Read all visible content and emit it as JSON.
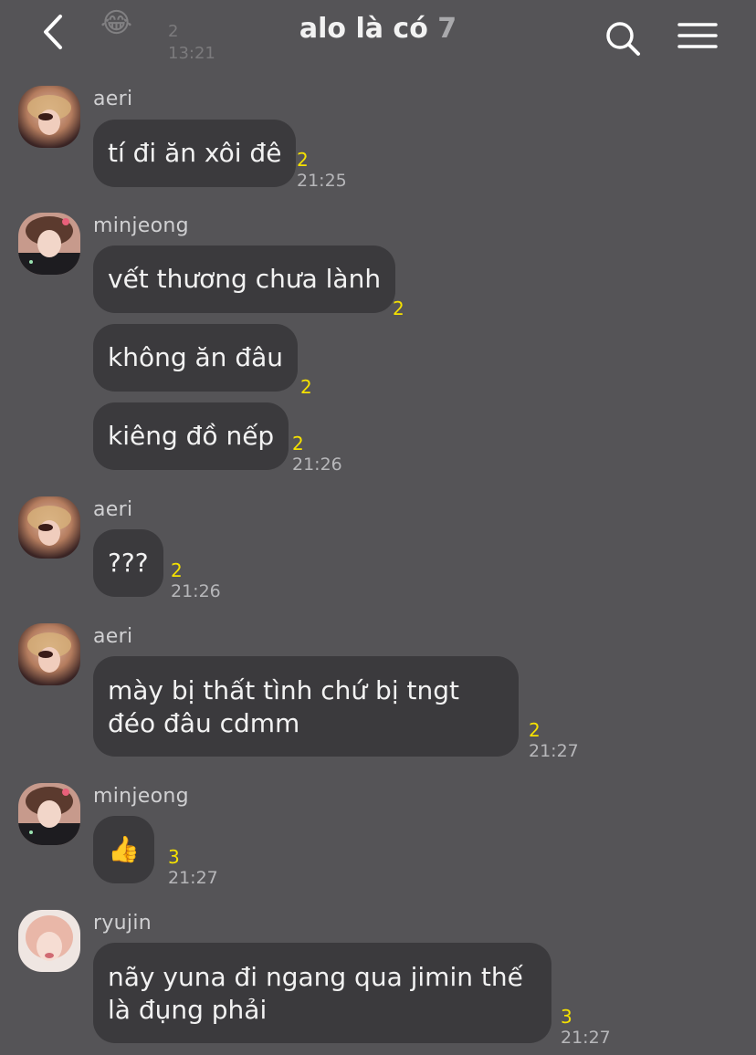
{
  "header": {
    "title": "alo là có",
    "member_count": "7",
    "back_icon": "chevron-left-icon",
    "search_icon": "search-icon",
    "menu_icon": "hamburger-menu-icon"
  },
  "ghost_message": {
    "emoji": "😂",
    "unread": "2",
    "time": "13:21"
  },
  "messages": [
    {
      "sender": "aeri",
      "avatar": "avatar-aeri",
      "bubbles": [
        {
          "text": "tí đi ăn xôi đê",
          "unread": "2",
          "time": "21:25"
        }
      ]
    },
    {
      "sender": "minjeong",
      "avatar": "avatar-minjeong",
      "bubbles": [
        {
          "text": "vết thương chưa lành",
          "unread": "2",
          "time": ""
        },
        {
          "text": "không ăn đâu",
          "unread": "2",
          "time": ""
        },
        {
          "text": "kiêng đồ nếp",
          "unread": "2",
          "time": "21:26"
        }
      ]
    },
    {
      "sender": "aeri",
      "avatar": "avatar-aeri",
      "bubbles": [
        {
          "text": "???",
          "unread": "2",
          "time": "21:26"
        }
      ]
    },
    {
      "sender": "aeri",
      "avatar": "avatar-aeri",
      "bubbles": [
        {
          "text": "mày bị thất tình chứ bị tngt đéo đâu cdmm",
          "unread": "2",
          "time": "21:27"
        }
      ]
    },
    {
      "sender": "minjeong",
      "avatar": "avatar-minjeong",
      "bubbles": [
        {
          "text": "👍",
          "unread": "3",
          "time": "21:27"
        }
      ]
    },
    {
      "sender": "ryujin",
      "avatar": "avatar-ryujin",
      "bubbles": [
        {
          "text": "nãy yuna đi ngang qua jimin thế là đụng phải",
          "unread": "3",
          "time": "21:27"
        }
      ]
    }
  ]
}
